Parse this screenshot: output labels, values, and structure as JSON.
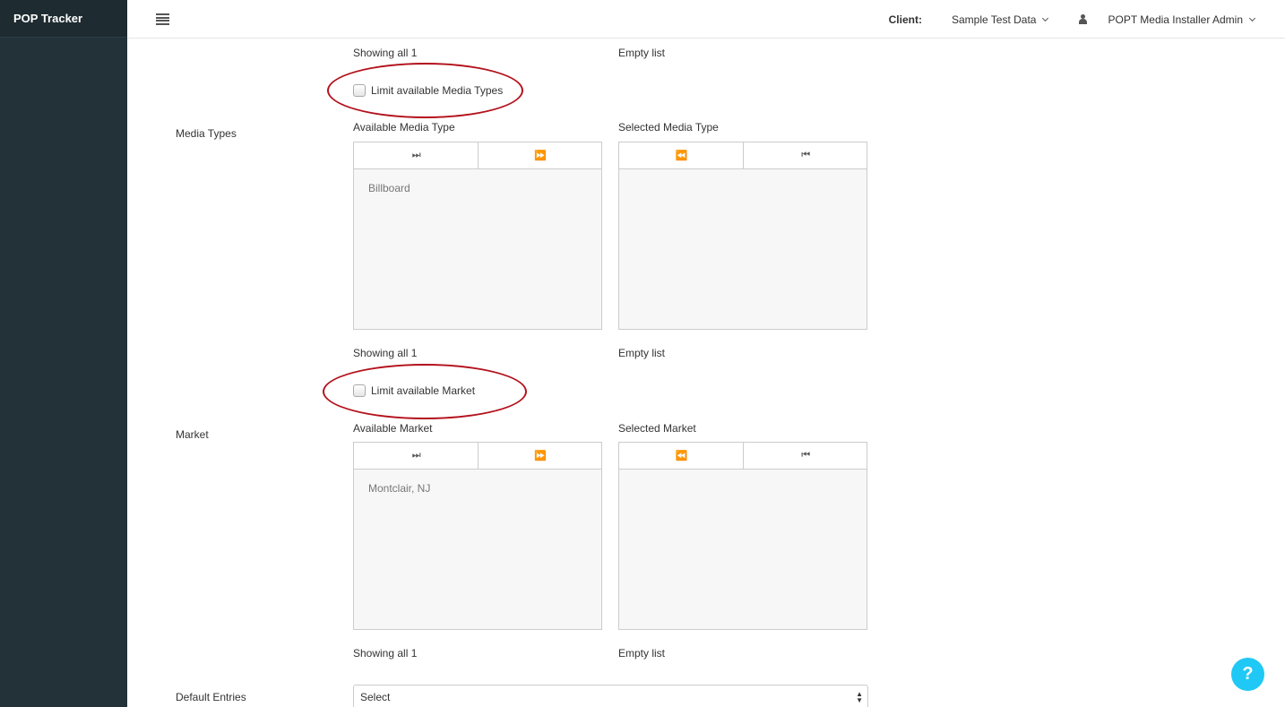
{
  "brand": "POP Tracker",
  "header": {
    "client_label": "Client:",
    "client_value": "Sample Test Data",
    "user_name": "POPT Media Installer Admin"
  },
  "top_section": {
    "available_status": "Showing all 1",
    "selected_status": "Empty list"
  },
  "media_types": {
    "checkbox_label": "Limit available Media Types",
    "row_label": "Media Types",
    "available_title": "Available Media Type",
    "selected_title": "Selected Media Type",
    "available_items": [
      "Billboard"
    ],
    "available_status": "Showing all 1",
    "selected_status": "Empty list",
    "move_all_icon": "⏭",
    "move_selected_icon": "⏩",
    "remove_selected_icon": "⏪",
    "remove_all_icon": "⏮"
  },
  "market": {
    "checkbox_label": "Limit available Market",
    "row_label": "Market",
    "available_title": "Available Market",
    "selected_title": "Selected Market",
    "available_items": [
      "Montclair, NJ"
    ],
    "available_status": "Showing all 1",
    "selected_status": "Empty list"
  },
  "default_entries": {
    "label": "Default Entries",
    "select_value": "Select"
  },
  "help_button": "?",
  "colors": {
    "sidebar": "#233238",
    "annotation_circle": "#b3111b",
    "help_button": "#1fc8f5"
  }
}
